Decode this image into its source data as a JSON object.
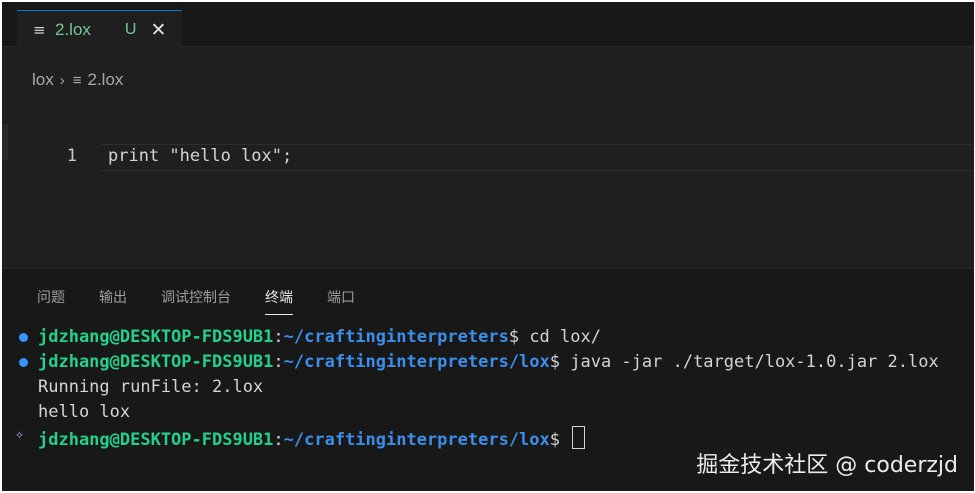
{
  "tab": {
    "icon": "text-file-icon",
    "label": "2.lox",
    "status": "U",
    "close_icon": "close-icon"
  },
  "breadcrumb": {
    "folder": "lox",
    "file": "2.lox"
  },
  "editor": {
    "lines": [
      {
        "number": "1",
        "text": "print \"hello lox\";"
      }
    ]
  },
  "panel": {
    "tabs": [
      "问题",
      "输出",
      "调试控制台",
      "终端",
      "端口"
    ],
    "active_tab": "终端"
  },
  "terminal": {
    "lines": [
      {
        "user": "jdzhang@DESKTOP-FDS9UB1",
        "sep": ":",
        "path": "~/craftinginterpreters",
        "prompt": "$",
        "command": " cd lox/"
      },
      {
        "user": "jdzhang@DESKTOP-FDS9UB1",
        "sep": ":",
        "path": "~/craftinginterpreters/lox",
        "prompt": "$",
        "command": " java -jar ./target/lox-1.0.jar 2.lox"
      },
      {
        "output": "Running runFile: 2.lox"
      },
      {
        "output": "hello lox"
      },
      {
        "user": "jdzhang@DESKTOP-FDS9UB1",
        "sep": ":",
        "path": "~/craftinginterpreters/lox",
        "prompt": "$",
        "command": " "
      }
    ]
  },
  "watermark": "掘金技术社区 @ coderzjd",
  "colors": {
    "user": "#23d18b",
    "path": "#3b8eea",
    "tab_label": "#73c991",
    "dot": "#3794ff"
  }
}
